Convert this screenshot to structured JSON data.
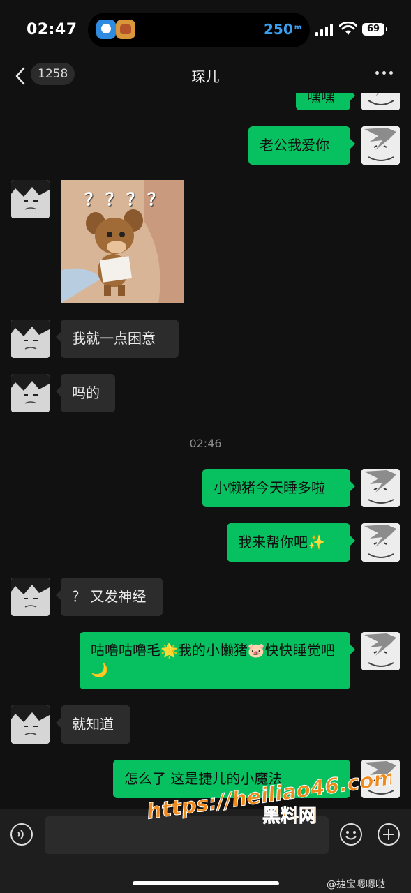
{
  "status_bar": {
    "time": "02:47",
    "distance": "250",
    "distance_unit": "m",
    "battery": "69"
  },
  "nav": {
    "back_count": "1258",
    "title": "琛儿"
  },
  "messages": [
    {
      "side": "out",
      "text": "嘿嘿"
    },
    {
      "side": "out",
      "text": "老公我爱你"
    },
    {
      "side": "in",
      "type": "sticker",
      "caption": "？？？？"
    },
    {
      "side": "in",
      "text": "我就一点困意"
    },
    {
      "side": "in",
      "text": "吗的"
    },
    {
      "type": "time",
      "text": "02:46"
    },
    {
      "side": "out",
      "text": "小懒猪今天睡多啦"
    },
    {
      "side": "out",
      "text": "我来帮你吧✨"
    },
    {
      "side": "in",
      "text": "？ 又发神经"
    },
    {
      "side": "out",
      "text": "咕噜咕噜毛🌟我的小懒猪🐷快快睡觉吧🌙"
    },
    {
      "side": "in",
      "text": "就知道"
    },
    {
      "side": "out",
      "text": "怎么了 这是捷儿的小魔法"
    }
  ],
  "input": {
    "placeholder": ""
  },
  "watermark": {
    "url": "https://heiliao46.com",
    "name": "黑料网"
  },
  "credit": "@捷宝嗯嗯哒",
  "colors": {
    "bg": "#111111",
    "incoming": "#2c2c2c",
    "outgoing": "#07c160",
    "watermark": "#f08a1d"
  }
}
